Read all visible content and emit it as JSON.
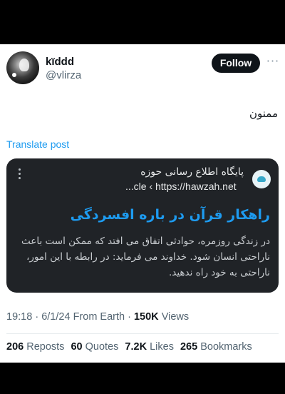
{
  "user": {
    "name": "kïddd",
    "handle": "@vlirza",
    "follow_label": "Follow",
    "more_icon": "more-horizontal-icon"
  },
  "tweet": {
    "text": "ممنون",
    "translate_label": "Translate post"
  },
  "quote_card": {
    "source_name": "پایگاه اطلاع رسانی حوزه",
    "url": "...cle ‹ https://hawzah.net",
    "title": "راهکار قرآن در باره افسردگی",
    "body": "در زندگی روزمره، حوادثی اتفاق می افتد که ممکن است باعث ناراحتی انسان شود. خداوند می فرماید: در رابطه با این امور، ناراحتی به خود راه ندهید.",
    "menu_icon": "vertical-dots-icon",
    "logo_icon": "hawzah-logo-icon"
  },
  "meta": {
    "time": "19:18",
    "separator": "·",
    "date": "6/1/24",
    "client": "From Earth",
    "views_count": "150K",
    "views_label": "Views"
  },
  "stats": {
    "reposts_count": "206",
    "reposts_label": "Reposts",
    "quotes_count": "60",
    "quotes_label": "Quotes",
    "likes_count": "7.2K",
    "likes_label": "Likes",
    "bookmarks_count": "265",
    "bookmarks_label": "Bookmarks"
  },
  "colors": {
    "accent": "#1d9bf0",
    "card_dark": "#202327",
    "muted": "#536471"
  }
}
